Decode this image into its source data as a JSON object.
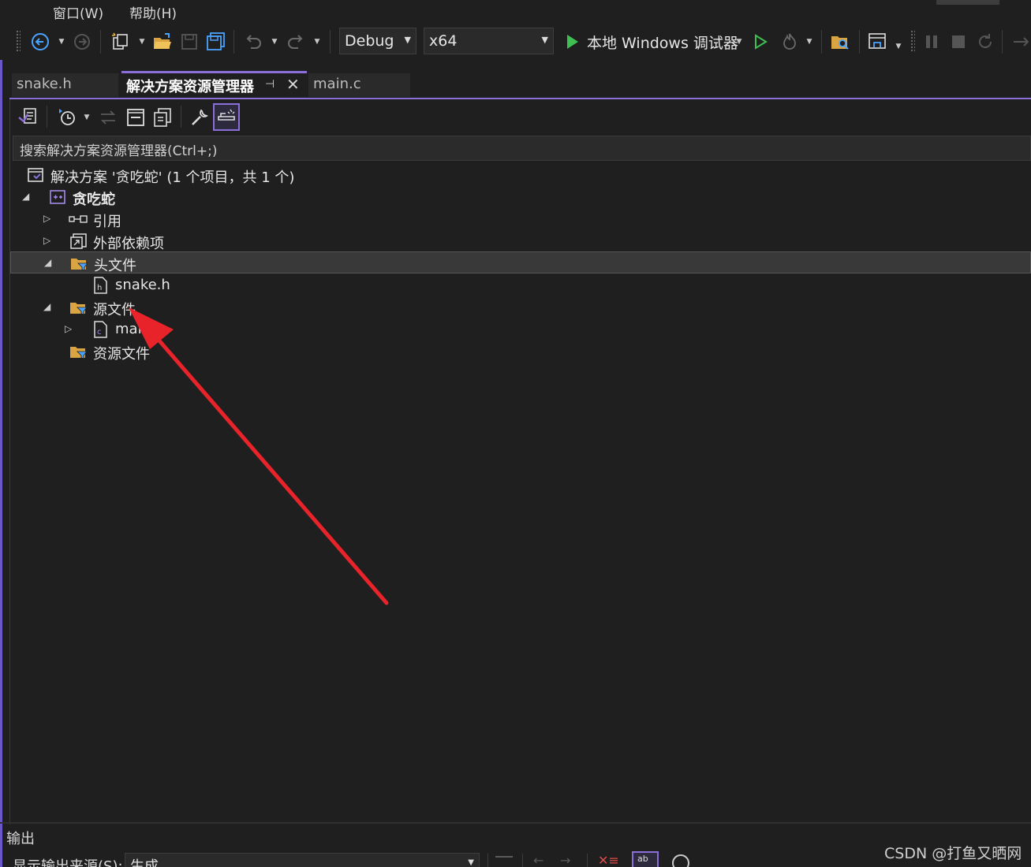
{
  "menu": {
    "window": "窗口(W)",
    "help": "帮助(H)"
  },
  "toolbar": {
    "config": "Debug",
    "platform": "x64",
    "run_label": "本地 Windows 调试器"
  },
  "tabs": [
    {
      "label": "snake.h"
    },
    {
      "label": "解决方案资源管理器"
    },
    {
      "label": "main.c"
    }
  ],
  "search": {
    "placeholder": "搜索解决方案资源管理器(Ctrl+;)"
  },
  "tree": {
    "solution": "解决方案 '贪吃蛇' (1 个项目，共 1 个)",
    "project": "贪吃蛇",
    "references": "引用",
    "external_deps": "外部依赖项",
    "header_files": "头文件",
    "header_file_1": "snake.h",
    "source_files": "源文件",
    "source_file_1": "main.c",
    "resource_files": "资源文件"
  },
  "output": {
    "title": "输出",
    "source_label": "显示输出来源(S):",
    "source_value": "生成"
  },
  "watermark": "CSDN @打鱼又晒网",
  "colors": {
    "accent": "#8a6fd8",
    "arrow": "#e8232a",
    "run_green": "#3fbf52"
  }
}
